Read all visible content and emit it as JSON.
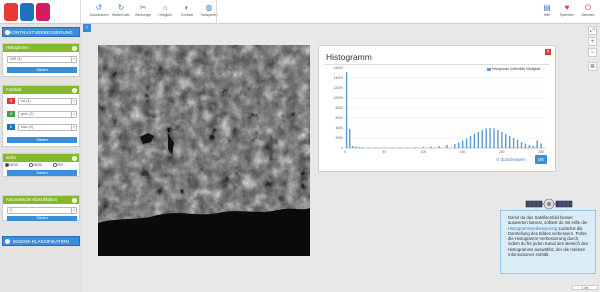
{
  "toolbar": {
    "left": [
      {
        "label": "Zurücksetzen",
        "icon": "undo-icon",
        "glyph": "↺"
      },
      {
        "label": "Wiederholen",
        "icon": "redo-icon",
        "glyph": "↻"
      },
      {
        "label": "Werkzeuge",
        "icon": "tools-icon",
        "glyph": "✂"
      },
      {
        "label": "Helligkeit",
        "icon": "brightness-icon",
        "glyph": "☼"
      },
      {
        "label": "Kontrast",
        "icon": "contrast-icon",
        "glyph": "◐"
      },
      {
        "label": "Transparenz",
        "icon": "transparency-icon",
        "glyph": "◍"
      }
    ],
    "right": [
      {
        "label": "Hilfe",
        "icon": "help-icon",
        "glyph": "▤"
      },
      {
        "label": "Speichern",
        "icon": "save-icon",
        "glyph": "♥"
      },
      {
        "label": "Beenden",
        "icon": "power-icon",
        "glyph": "⏻"
      }
    ],
    "colors": {
      "logo_red": "#e53935",
      "logo_blue": "#1e73be",
      "logo_pink": "#d81b60",
      "accent": "#3b8edc",
      "green": "#85b92c"
    }
  },
  "sidebar": {
    "top_button": "KONTRASTVERBESSERUNG",
    "histogram": {
      "title": "Histogramm",
      "select": "NIR (4)",
      "start": "Starten"
    },
    "farbbild": {
      "title": "Farbbild",
      "channels": [
        {
          "key": "R",
          "value": "rot (4)",
          "color": "#e53935"
        },
        {
          "key": "G",
          "value": "grün (2)",
          "color": "#43a047"
        },
        {
          "key": "B",
          "value": "blau (2)",
          "color": "#1e73be"
        }
      ],
      "start": "Starten"
    },
    "index": {
      "title": "Index",
      "options": [
        "NDVI",
        "NDSI",
        "RVI"
      ],
      "selected": "NDVI",
      "start": "Starten"
    },
    "classification": {
      "title": "Automatische Klassifikation",
      "select": "6",
      "start": "Starten"
    },
    "bottom_button": "EIGENE KLASSIFIKATION"
  },
  "dialog": {
    "title": "Histogramm",
    "reset": "Zurücksetzen",
    "ok": "OK"
  },
  "chart_data": {
    "type": "bar",
    "series": [
      {
        "name": "Histogramm (Intensität) Häufigkeit",
        "color": "#5b9bd5"
      }
    ],
    "xlim": [
      0,
      255
    ],
    "ylim": [
      0,
      16000
    ],
    "xticks": [
      "0",
      "50",
      "100",
      "150",
      "200",
      "250"
    ],
    "yticks": [
      "0",
      "2000",
      "4000",
      "6000",
      "8000",
      "10000",
      "12000",
      "14000",
      "16000"
    ],
    "x": [
      2,
      6,
      10,
      14,
      18,
      22,
      30,
      40,
      50,
      60,
      70,
      80,
      90,
      100,
      110,
      120,
      130,
      140,
      145,
      150,
      155,
      160,
      165,
      170,
      175,
      180,
      185,
      190,
      195,
      200,
      205,
      210,
      215,
      220,
      225,
      230,
      235,
      240,
      245,
      250
    ],
    "values": [
      15200,
      3800,
      400,
      300,
      200,
      150,
      100,
      100,
      100,
      100,
      100,
      120,
      150,
      200,
      300,
      400,
      600,
      800,
      1100,
      1500,
      1900,
      2400,
      2800,
      3200,
      3600,
      3900,
      4000,
      3900,
      3600,
      3200,
      2800,
      2400,
      2000,
      1600,
      1200,
      900,
      600,
      400,
      1500,
      900
    ],
    "grid": true,
    "legend": "top-right"
  },
  "help": {
    "text1": "Damit du das Satellitenbild besser auswerten kannst, solltest du mit Hilfe der",
    "link": "Histogrammverbesserung",
    "text2": "zunächst die Darstellung des Bildes verbessern. Führe die Histogramm-Verbesserung durch, indem du für jeden Kanal den Bereich des Histogramms auswählst, der die meisten Informationen enthält."
  },
  "zoom": "1 km"
}
